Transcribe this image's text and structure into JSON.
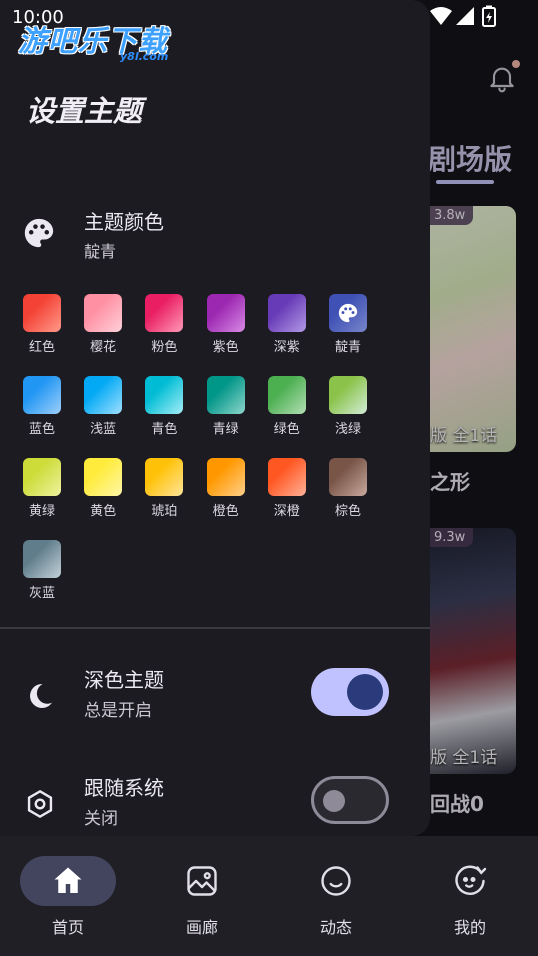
{
  "status_bar": {
    "time": "10:00"
  },
  "watermark": {
    "main": "游吧乐下载",
    "sub": "y8l.com"
  },
  "background": {
    "tab_label": "剧场版",
    "cards": [
      {
        "badge": "3.8w",
        "episode": "版 全1话",
        "title": "之形"
      },
      {
        "badge": "9.3w",
        "episode": "版 全1话",
        "title": "回战0"
      }
    ]
  },
  "drawer": {
    "title": "设置主题",
    "theme_color": {
      "label": "主题颜色",
      "value": "靛青"
    },
    "swatches": [
      {
        "label": "红色",
        "from": "#f44336",
        "to": "#ff9a8a"
      },
      {
        "label": "樱花",
        "from": "#ff8fa3",
        "to": "#ffd1d9"
      },
      {
        "label": "粉色",
        "from": "#e91e63",
        "to": "#ff9ab8"
      },
      {
        "label": "紫色",
        "from": "#9c27b0",
        "to": "#d88be6"
      },
      {
        "label": "深紫",
        "from": "#673ab7",
        "to": "#b39ae6"
      },
      {
        "label": "靛青",
        "from": "#3f51b5",
        "to": "#7986cb",
        "selected": true
      },
      {
        "label": "蓝色",
        "from": "#2196f3",
        "to": "#9ed0fb"
      },
      {
        "label": "浅蓝",
        "from": "#03a9f4",
        "to": "#9fe0ff"
      },
      {
        "label": "青色",
        "from": "#00bcd4",
        "to": "#a6eef8"
      },
      {
        "label": "青绿",
        "from": "#009688",
        "to": "#8fd6cc"
      },
      {
        "label": "绿色",
        "from": "#4caf50",
        "to": "#b3e0b5"
      },
      {
        "label": "浅绿",
        "from": "#8bc34a",
        "to": "#d3ecd8"
      },
      {
        "label": "黄绿",
        "from": "#cddc39",
        "to": "#eef39f"
      },
      {
        "label": "黄色",
        "from": "#ffeb3b",
        "to": "#fff7a8"
      },
      {
        "label": "琥珀",
        "from": "#ffc107",
        "to": "#ffe59a"
      },
      {
        "label": "橙色",
        "from": "#ff9800",
        "to": "#ffd08a"
      },
      {
        "label": "深橙",
        "from": "#ff5722",
        "to": "#ffb199"
      },
      {
        "label": "棕色",
        "from": "#795548",
        "to": "#c9aa9f"
      },
      {
        "label": "灰蓝",
        "from": "#607d8b",
        "to": "#c4d2d9"
      }
    ],
    "dark_theme": {
      "label": "深色主题",
      "value": "总是开启",
      "enabled": true
    },
    "follow_system": {
      "label": "跟随系统",
      "value": "关闭",
      "enabled": false
    }
  },
  "bottom_nav": [
    {
      "label": "首页",
      "icon": "home-icon",
      "active": true
    },
    {
      "label": "画廊",
      "icon": "gallery-icon",
      "active": false
    },
    {
      "label": "动态",
      "icon": "smile-icon",
      "active": false
    },
    {
      "label": "我的",
      "icon": "profile-icon",
      "active": false
    }
  ],
  "colors": {
    "drawer_bg": "#1c1b21",
    "accent": "#bfc2ff",
    "toggle_knob_on": "#2b3a7a",
    "nav_active_pill": "#43455f"
  }
}
